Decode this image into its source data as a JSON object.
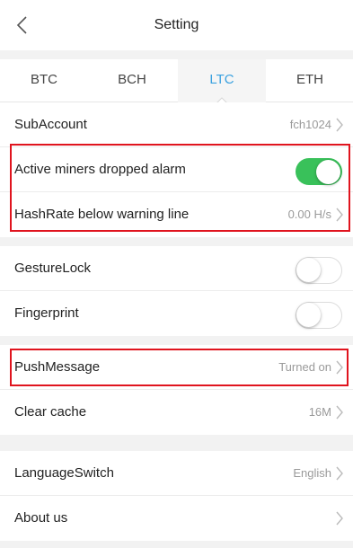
{
  "header": {
    "title": "Setting",
    "back_icon": "chevron-left-icon"
  },
  "tabs": [
    {
      "label": "BTC",
      "active": false
    },
    {
      "label": "BCH",
      "active": false
    },
    {
      "label": "LTC",
      "active": true
    },
    {
      "label": "ETH",
      "active": false
    }
  ],
  "account": {
    "subaccount_label": "SubAccount",
    "subaccount_value": "fch1024"
  },
  "alarms": {
    "miners_alarm_label": "Active miners dropped alarm",
    "miners_alarm_on": true,
    "hashrate_label": "HashRate below warning line",
    "hashrate_value": "0.00 H/s"
  },
  "security": {
    "gesture_label": "GestureLock",
    "gesture_on": false,
    "fingerprint_label": "Fingerprint",
    "fingerprint_on": false
  },
  "push": {
    "label": "PushMessage",
    "value": "Turned on"
  },
  "cache": {
    "label": "Clear cache",
    "value": "16M"
  },
  "misc": {
    "language_label": "LanguageSwitch",
    "language_value": "English",
    "about_label": "About us"
  },
  "colors": {
    "accent": "#3aa1e0",
    "toggle_on": "#39c15a",
    "highlight": "#e0141e"
  }
}
